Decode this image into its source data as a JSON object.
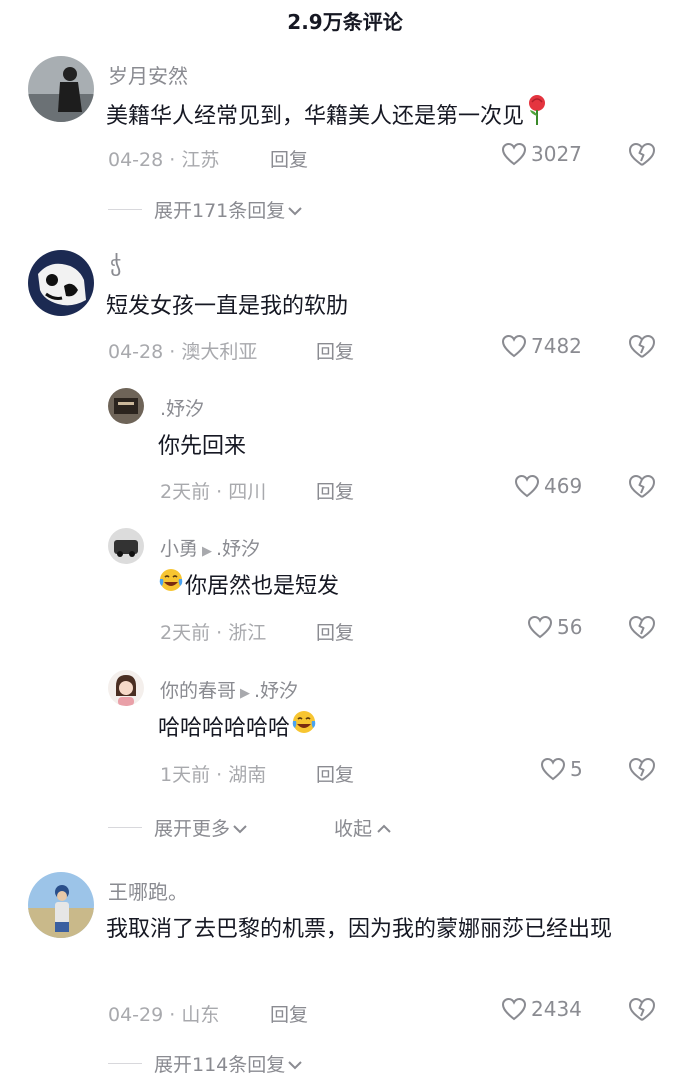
{
  "header": {
    "title": "2.9万条评论"
  },
  "comments": [
    {
      "user": "岁月安然",
      "text": "美籍华人经常见到，华籍美人还是第一次见",
      "date": "04-28",
      "location": "江苏",
      "reply": "回复",
      "likes": "3027",
      "expand": "展开171条回复"
    },
    {
      "user": "ჭ",
      "text": "短发女孩一直是我的软肋",
      "date": "04-28",
      "location": "澳大利亚",
      "reply": "回复",
      "likes": "7482",
      "replies": [
        {
          "user": ".妤汐",
          "to": "",
          "text": "你先回来",
          "date": "2天前",
          "location": "四川",
          "reply": "回复",
          "likes": "469"
        },
        {
          "user": "小勇",
          "to": ".妤汐",
          "text": "你居然也是短发",
          "date": "2天前",
          "location": "浙江",
          "reply": "回复",
          "likes": "56"
        },
        {
          "user": "你的春哥",
          "to": ".妤汐",
          "text": "哈哈哈哈哈哈",
          "date": "1天前",
          "location": "湖南",
          "reply": "回复",
          "likes": "5"
        }
      ],
      "expand_more": "展开更多",
      "collapse": "收起"
    },
    {
      "user": "王哪跑。",
      "text": "我取消了去巴黎的机票，因为我的蒙娜丽莎已经出现",
      "date": "04-29",
      "location": "山东",
      "reply": "回复",
      "likes": "2434",
      "expand": "展开114条回复"
    }
  ],
  "icons": {
    "like": "heart-outline-icon",
    "dislike": "broken-heart-icon",
    "emoji": "laughing-tears-emoji",
    "rose": "rose-emoji"
  }
}
